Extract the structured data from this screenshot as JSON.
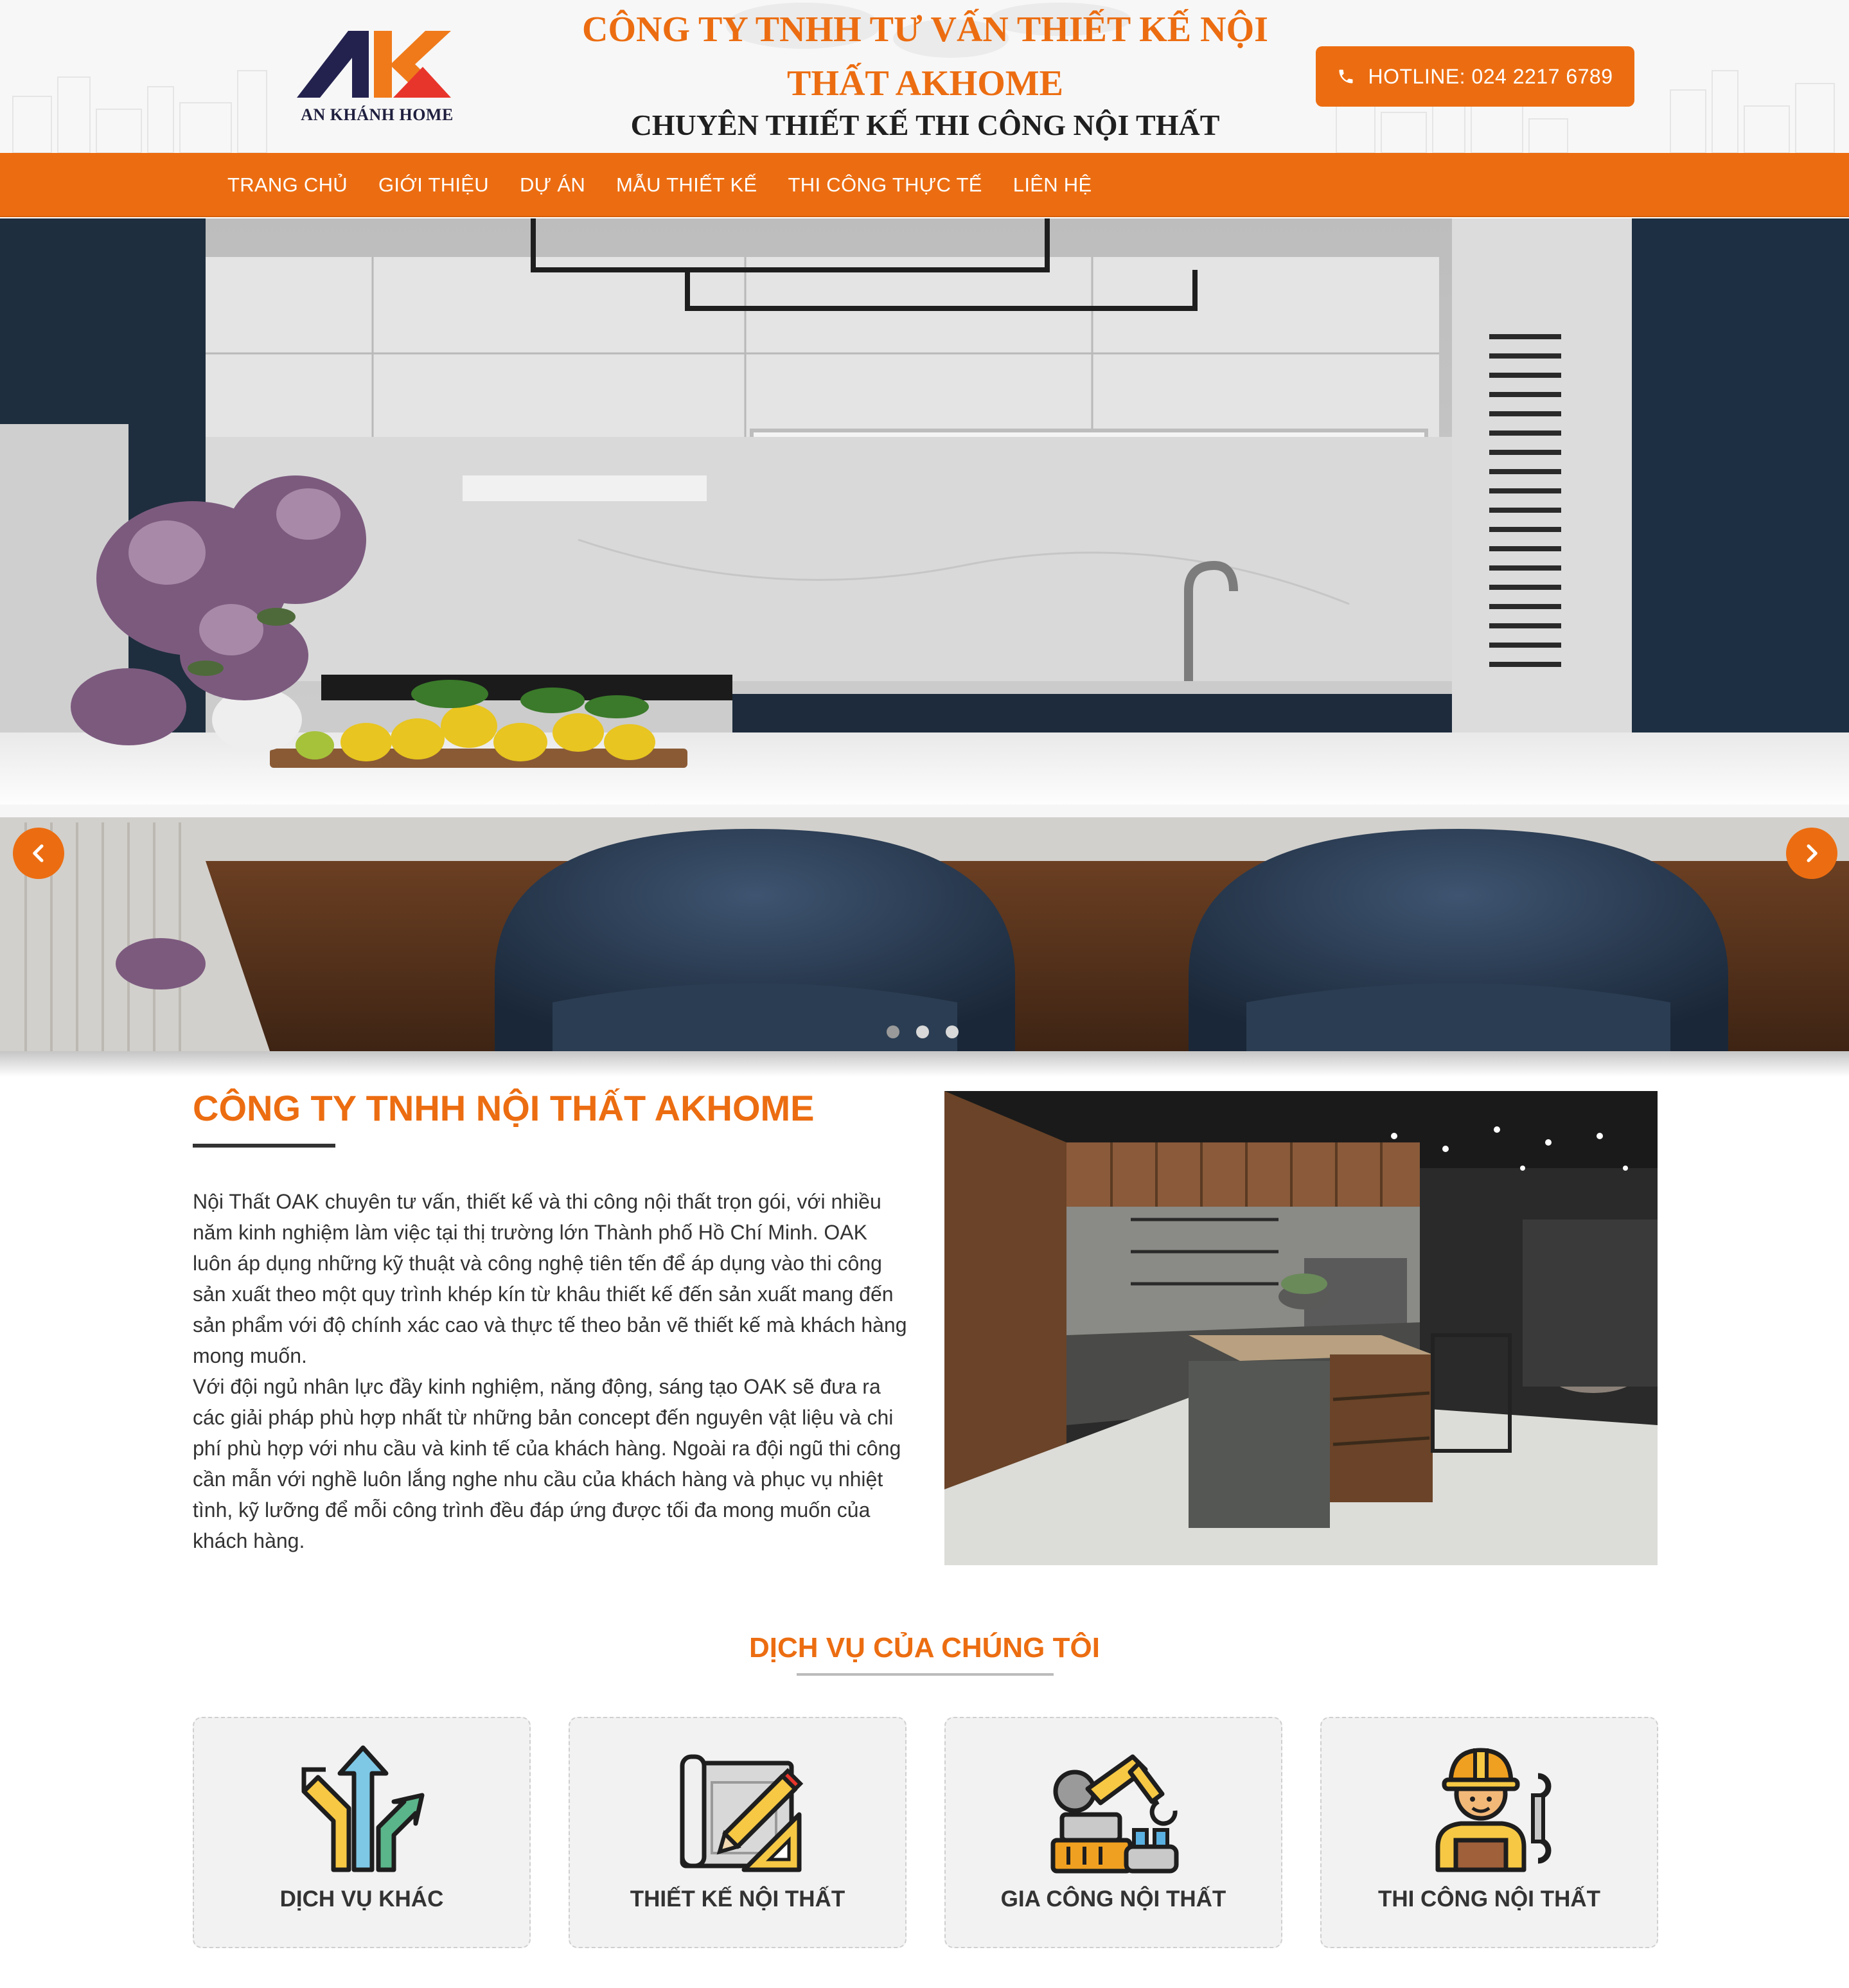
{
  "header": {
    "logo_text": "AN KHÁNH HOME",
    "title_line1": "CÔNG TY TNHH TƯ VẤN THIẾT KẾ NỘI",
    "title_line2": "THẤT AKHOME",
    "subtitle": "CHUYÊN THIẾT KẾ THI CÔNG NỘI THẤT",
    "hotline": "HOTLINE: 024 2217 6789"
  },
  "nav": {
    "items": [
      "TRANG CHỦ",
      "GIỚI THIỆU",
      "DỰ ÁN",
      "MẪU THIẾT KẾ",
      "THI CÔNG THỰC TẾ",
      "LIÊN HỆ"
    ]
  },
  "slider": {
    "dots_count": 3,
    "active_dot": 0
  },
  "about": {
    "title": "CÔNG TY TNHH NỘI THẤT AKHOME",
    "paragraph1": "Nội Thất OAK chuyên tư vấn, thiết kế và thi công nội thất trọn gói, với nhiều năm kinh nghiệm làm việc tại thị trường lớn Thành phố Hồ Chí Minh. OAK luôn áp dụng những kỹ thuật và công nghệ tiên tến để áp dụng vào thi công sản xuất theo một quy trình khép kín từ khâu thiết kế đến sản xuất mang đến sản phẩm với độ chính xác cao và thực tế theo bản vẽ thiết kế mà khách hàng mong muốn.",
    "paragraph2": "Với đội ngủ nhân lực đầy kinh nghiệm, năng động, sáng tạo OAK sẽ đưa ra các giải pháp phù hợp nhất từ những bản concept đến nguyên vật liệu và chi phí phù hợp với nhu cầu và kinh tế của khách hàng. Ngoài ra đội ngũ thi công cần mẫn với nghề luôn lắng nghe nhu cầu của khách hàng và phục vụ nhiệt tình, kỹ lưỡng để mỗi công trình đều đáp ứng được tối đa mong muốn của khách hàng."
  },
  "services": {
    "title": "DỊCH VỤ CỦA CHÚNG TÔI",
    "items": [
      {
        "label": "DỊCH VỤ KHÁC",
        "icon": "arrows-icon"
      },
      {
        "label": "THIẾT KẾ NỘI THẤT",
        "icon": "blueprint-pencil-icon"
      },
      {
        "label": "GIA CÔNG NỘI THẤT",
        "icon": "robot-arm-icon"
      },
      {
        "label": "THI CÔNG NỘI THẤT",
        "icon": "worker-icon"
      }
    ]
  },
  "colors": {
    "accent": "#ec6d11",
    "text": "#333333",
    "logo_navy": "#23224f",
    "logo_red": "#e8352b"
  }
}
